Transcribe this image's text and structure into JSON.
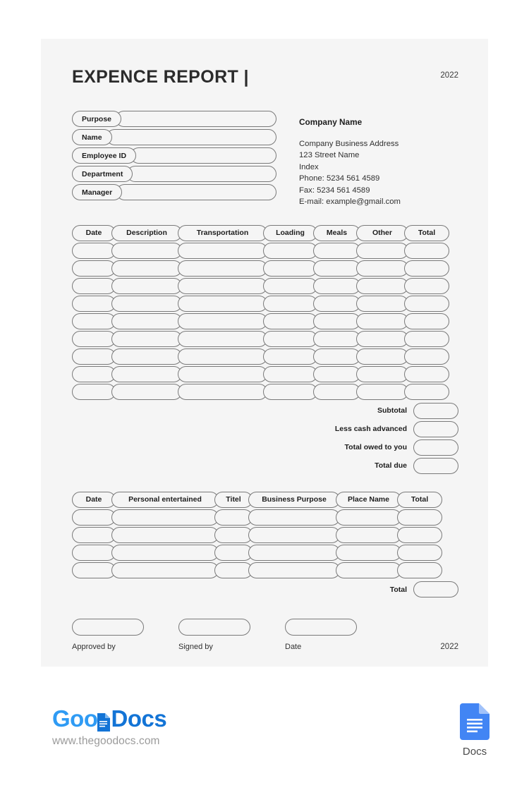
{
  "document": {
    "title": "EXPENCE REPORT |",
    "year_top": "2022",
    "year_bottom": "2022"
  },
  "form": {
    "rows": [
      {
        "label": "Purpose",
        "value": ""
      },
      {
        "label": "Name",
        "value": ""
      },
      {
        "label": "Employee ID",
        "value": ""
      },
      {
        "label": "Department",
        "value": ""
      },
      {
        "label": "Manager",
        "value": ""
      }
    ]
  },
  "company": {
    "name": "Company Name",
    "address": "Company Business Address",
    "street": "123 Street Name",
    "index": "Index",
    "phone": "Phone: 5234 561 4589",
    "fax": "Fax: 5234 561 4589",
    "email": "E-mail: example@gmail.com"
  },
  "expense_table": {
    "headers": [
      "Date",
      "Description",
      "Transportation",
      "Loading",
      "Meals",
      "Other",
      "Total"
    ],
    "row_count": 9,
    "rows": [
      [
        "",
        "",
        "",
        "",
        "",
        "",
        ""
      ],
      [
        "",
        "",
        "",
        "",
        "",
        "",
        ""
      ],
      [
        "",
        "",
        "",
        "",
        "",
        "",
        ""
      ],
      [
        "",
        "",
        "",
        "",
        "",
        "",
        ""
      ],
      [
        "",
        "",
        "",
        "",
        "",
        "",
        ""
      ],
      [
        "",
        "",
        "",
        "",
        "",
        "",
        ""
      ],
      [
        "",
        "",
        "",
        "",
        "",
        "",
        ""
      ],
      [
        "",
        "",
        "",
        "",
        "",
        "",
        ""
      ],
      [
        "",
        "",
        "",
        "",
        "",
        "",
        ""
      ]
    ]
  },
  "totals": [
    {
      "label": "Subtotal",
      "value": ""
    },
    {
      "label": "Less cash advanced",
      "value": ""
    },
    {
      "label": "Total owed to you",
      "value": ""
    },
    {
      "label": "Total due",
      "value": ""
    }
  ],
  "entertainment_table": {
    "headers": [
      "Date",
      "Personal entertained",
      "Titel",
      "Business Purpose",
      "Place Name",
      "Total"
    ],
    "row_count": 4,
    "rows": [
      [
        "",
        "",
        "",
        "",
        "",
        ""
      ],
      [
        "",
        "",
        "",
        "",
        "",
        ""
      ],
      [
        "",
        "",
        "",
        "",
        "",
        ""
      ],
      [
        "",
        "",
        "",
        "",
        "",
        ""
      ]
    ],
    "total_label": "Total",
    "total_value": ""
  },
  "signatures": [
    {
      "label": "Approved by",
      "value": ""
    },
    {
      "label": "Signed by",
      "value": ""
    },
    {
      "label": "Date",
      "value": ""
    }
  ],
  "footer": {
    "brand_part1": "Goo",
    "brand_part2": "Docs",
    "url": "www.thegoodocs.com",
    "docs_label": "Docs"
  },
  "colors": {
    "page_background": "#f5f5f5",
    "canvas": "#ffffff",
    "pill_border": "#7a7a7a",
    "text": "#1d1d1d",
    "brand_light_blue": "#2f9bf4",
    "brand_dark_blue": "#1374d6",
    "docs_icon_blue": "#4285f4",
    "url_gray": "#9b9b9b"
  }
}
